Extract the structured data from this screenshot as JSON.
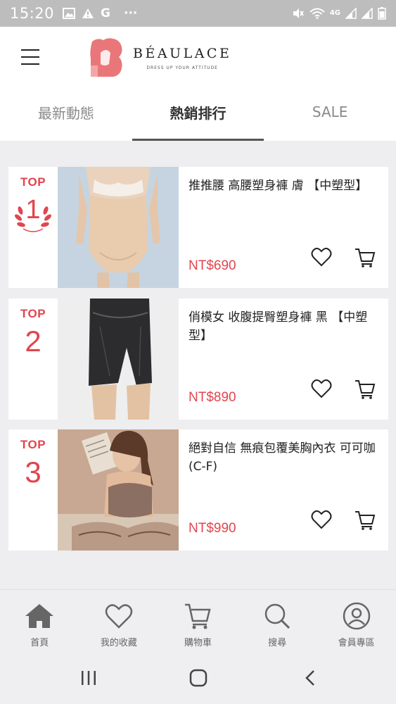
{
  "status_bar": {
    "time": "15:20",
    "left_icons": [
      "image-icon",
      "warning-icon",
      "google-icon",
      "more-dots-icon"
    ],
    "right_icons": [
      "mute-icon",
      "wifi-icon",
      "signal-icon",
      "signal-icon",
      "battery-icon"
    ],
    "network": "4G",
    "dots": "···"
  },
  "header": {
    "brand_name": "BÉAULACE",
    "brand_tagline": "DRESS UP YOUR ATTITUDE"
  },
  "tabs": [
    {
      "label": "最新動態",
      "active": false
    },
    {
      "label": "熱銷排行",
      "active": true
    },
    {
      "label": "SALE",
      "active": false
    }
  ],
  "products": [
    {
      "rank_label": "TOP",
      "rank": "1",
      "title": "推推腰 高腰塑身褲 膚 【中塑型】",
      "price": "NT$690"
    },
    {
      "rank_label": "TOP",
      "rank": "2",
      "title": "俏模女 收腹提臀塑身褲 黑 【中塑型】",
      "price": "NT$890"
    },
    {
      "rank_label": "TOP",
      "rank": "3",
      "title": "絕對自信 無痕包覆美胸內衣 可可咖 (C-F)",
      "price": "NT$990"
    }
  ],
  "bottom_nav": [
    {
      "label": "首頁",
      "icon": "home-icon"
    },
    {
      "label": "我的收藏",
      "icon": "heart-icon"
    },
    {
      "label": "購物車",
      "icon": "cart-icon"
    },
    {
      "label": "搜尋",
      "icon": "search-icon"
    },
    {
      "label": "會員專區",
      "icon": "user-icon"
    }
  ],
  "colors": {
    "accent_red": "#e2454e",
    "logo_pink": "#e9777a",
    "status_bar": "#bdbdbd",
    "content_bg": "#eeedef"
  }
}
